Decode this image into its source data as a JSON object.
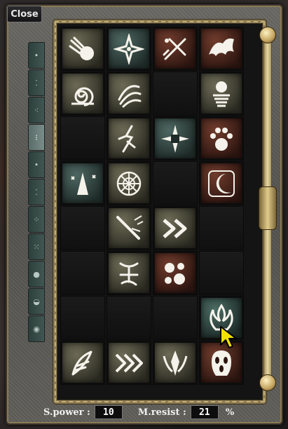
{
  "window": {
    "close_label": "Close"
  },
  "sidebar": {
    "tabs": [
      {
        "glyph": "•",
        "active": false
      },
      {
        "glyph": "⁚",
        "active": false
      },
      {
        "glyph": "⁖",
        "active": false
      },
      {
        "glyph": "⁝",
        "active": true
      },
      {
        "glyph": "•",
        "active": false
      },
      {
        "glyph": "⁚",
        "active": false
      },
      {
        "glyph": "⁘",
        "active": false
      },
      {
        "glyph": "⁙",
        "active": false
      },
      {
        "glyph": "●",
        "active": false
      },
      {
        "glyph": "◒",
        "active": false
      },
      {
        "glyph": "◉",
        "active": false
      }
    ]
  },
  "skills": [
    [
      {
        "name": "fireball-icon",
        "tint": "olive"
      },
      {
        "name": "shuriken-icon",
        "tint": "teal"
      },
      {
        "name": "crossed-swords-icon",
        "tint": "rust"
      },
      {
        "name": "bat-wing-icon",
        "tint": "rust"
      }
    ],
    [
      {
        "name": "spiral-shell-icon",
        "tint": "olive"
      },
      {
        "name": "claw-swirl-icon",
        "tint": "olive"
      },
      {
        "name": "empty",
        "tint": ""
      },
      {
        "name": "orb-spring-icon",
        "tint": "olive"
      }
    ],
    [
      {
        "name": "empty",
        "tint": ""
      },
      {
        "name": "lightning-root-icon",
        "tint": "olive"
      },
      {
        "name": "star-burst-icon",
        "tint": "teal"
      },
      {
        "name": "paw-print-icon",
        "tint": "rust"
      }
    ],
    [
      {
        "name": "mage-sparkle-icon",
        "tint": "teal"
      },
      {
        "name": "web-wheel-icon",
        "tint": "olive"
      },
      {
        "name": "empty",
        "tint": ""
      },
      {
        "name": "crescent-moon-icon",
        "tint": "rust"
      }
    ],
    [
      {
        "name": "empty",
        "tint": ""
      },
      {
        "name": "spear-strike-icon",
        "tint": "olive"
      },
      {
        "name": "double-chevron-icon",
        "tint": "olive"
      },
      {
        "name": "empty",
        "tint": ""
      }
    ],
    [
      {
        "name": "empty",
        "tint": ""
      },
      {
        "name": "rune-glyph-icon",
        "tint": "olive"
      },
      {
        "name": "rock-debris-icon",
        "tint": "rust"
      },
      {
        "name": "empty",
        "tint": ""
      }
    ],
    [
      {
        "name": "empty",
        "tint": ""
      },
      {
        "name": "empty",
        "tint": ""
      },
      {
        "name": "empty",
        "tint": ""
      },
      {
        "name": "flame-aura-icon",
        "tint": "green"
      }
    ],
    [
      {
        "name": "wind-feather-icon",
        "tint": "olive"
      },
      {
        "name": "triple-chevron-icon",
        "tint": "olive"
      },
      {
        "name": "blade-emblem-icon",
        "tint": "olive"
      },
      {
        "name": "ghost-mask-icon",
        "tint": "rust"
      }
    ]
  ],
  "stats": {
    "spower_label": "S.power :",
    "spower_value": "10",
    "mresist_label": "M.resist :",
    "mresist_value": "21",
    "mresist_unit": "%"
  },
  "colors": {
    "frame_gold": "#8b7b52",
    "rope_gold": "#c2ad76",
    "cursor_yellow": "#f2e000"
  }
}
